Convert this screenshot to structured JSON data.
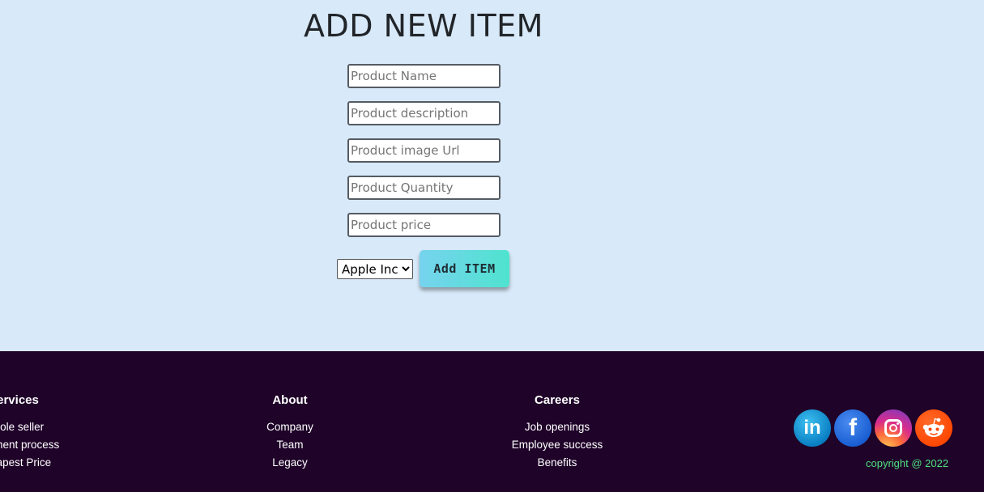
{
  "form": {
    "title": "ADD NEW ITEM",
    "fields": [
      {
        "placeholder": "Product Name",
        "value": ""
      },
      {
        "placeholder": "Product description",
        "value": ""
      },
      {
        "placeholder": "Product image Url",
        "value": ""
      },
      {
        "placeholder": "Product Quantity",
        "value": ""
      },
      {
        "placeholder": "Product price",
        "value": ""
      }
    ],
    "brand_select": {
      "selected": "Apple Inc."
    },
    "submit_label": "Add ITEM"
  },
  "footer": {
    "services": {
      "heading": "Services",
      "links": [
        "Whole seller",
        "Fulfillment process",
        "Cheapest Price"
      ]
    },
    "about": {
      "heading": "About",
      "links": [
        "Company",
        "Team",
        "Legacy"
      ]
    },
    "careers": {
      "heading": "Careers",
      "links": [
        "Job openings",
        "Employee success",
        "Benefits"
      ]
    },
    "social": [
      {
        "name": "linkedin-icon",
        "glyph": "in"
      },
      {
        "name": "facebook-icon",
        "glyph": "f"
      },
      {
        "name": "instagram-icon",
        "glyph": ""
      },
      {
        "name": "reddit-icon",
        "glyph": ""
      }
    ],
    "copyright": "copyright @ 2022"
  },
  "colors": {
    "page_background": "#d8e9f9",
    "footer_background": "#1f0329",
    "copyright_text": "#4ee07f",
    "button_gradient_start": "#76d3ee",
    "button_gradient_end": "#4fe3cf"
  }
}
